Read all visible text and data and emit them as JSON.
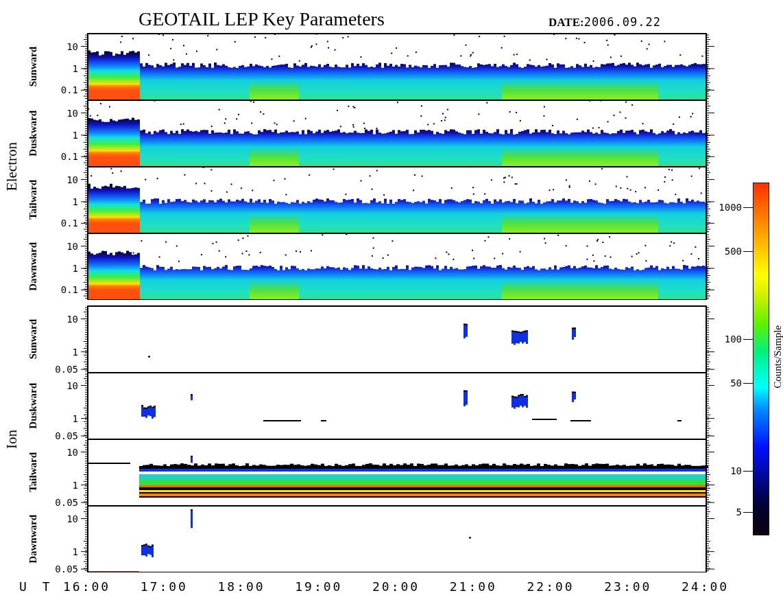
{
  "title": "GEOTAIL LEP Key Parameters",
  "date": {
    "label": "DATE:",
    "value": "2006.09.22"
  },
  "groups": [
    {
      "name": "Electron",
      "kind": "electron",
      "panels": [
        {
          "direction": "Sunward",
          "y_ticks": [
            "10",
            "1",
            "0.1"
          ]
        },
        {
          "direction": "Duskward",
          "y_ticks": [
            "10",
            "1",
            "0.1"
          ]
        },
        {
          "direction": "Tailward",
          "y_ticks": [
            "10",
            "1",
            "0.1"
          ]
        },
        {
          "direction": "Dawnward",
          "y_ticks": [
            "10",
            "1",
            "0.1"
          ]
        }
      ]
    },
    {
      "name": "Ion",
      "kind": "ion",
      "panels": [
        {
          "direction": "Sunward",
          "y_ticks": [
            "10",
            "1",
            "0.05"
          ]
        },
        {
          "direction": "Duskward",
          "y_ticks": [
            "10",
            "1",
            "0.05"
          ]
        },
        {
          "direction": "Tailward",
          "y_ticks": [
            "10",
            "1",
            "0.05"
          ]
        },
        {
          "direction": "Dawnward",
          "y_ticks": [
            "10",
            "1",
            "0.05"
          ]
        }
      ]
    }
  ],
  "x_axis": {
    "label": "U T",
    "ticks": [
      "16:00",
      "17:00",
      "18:00",
      "19:00",
      "20:00",
      "21:00",
      "22:00",
      "23:00",
      "24:00"
    ]
  },
  "colorbar": {
    "title": "Counts/Sample",
    "ticks": [
      "1000",
      "500",
      "100",
      "50",
      "10",
      "5"
    ]
  }
}
